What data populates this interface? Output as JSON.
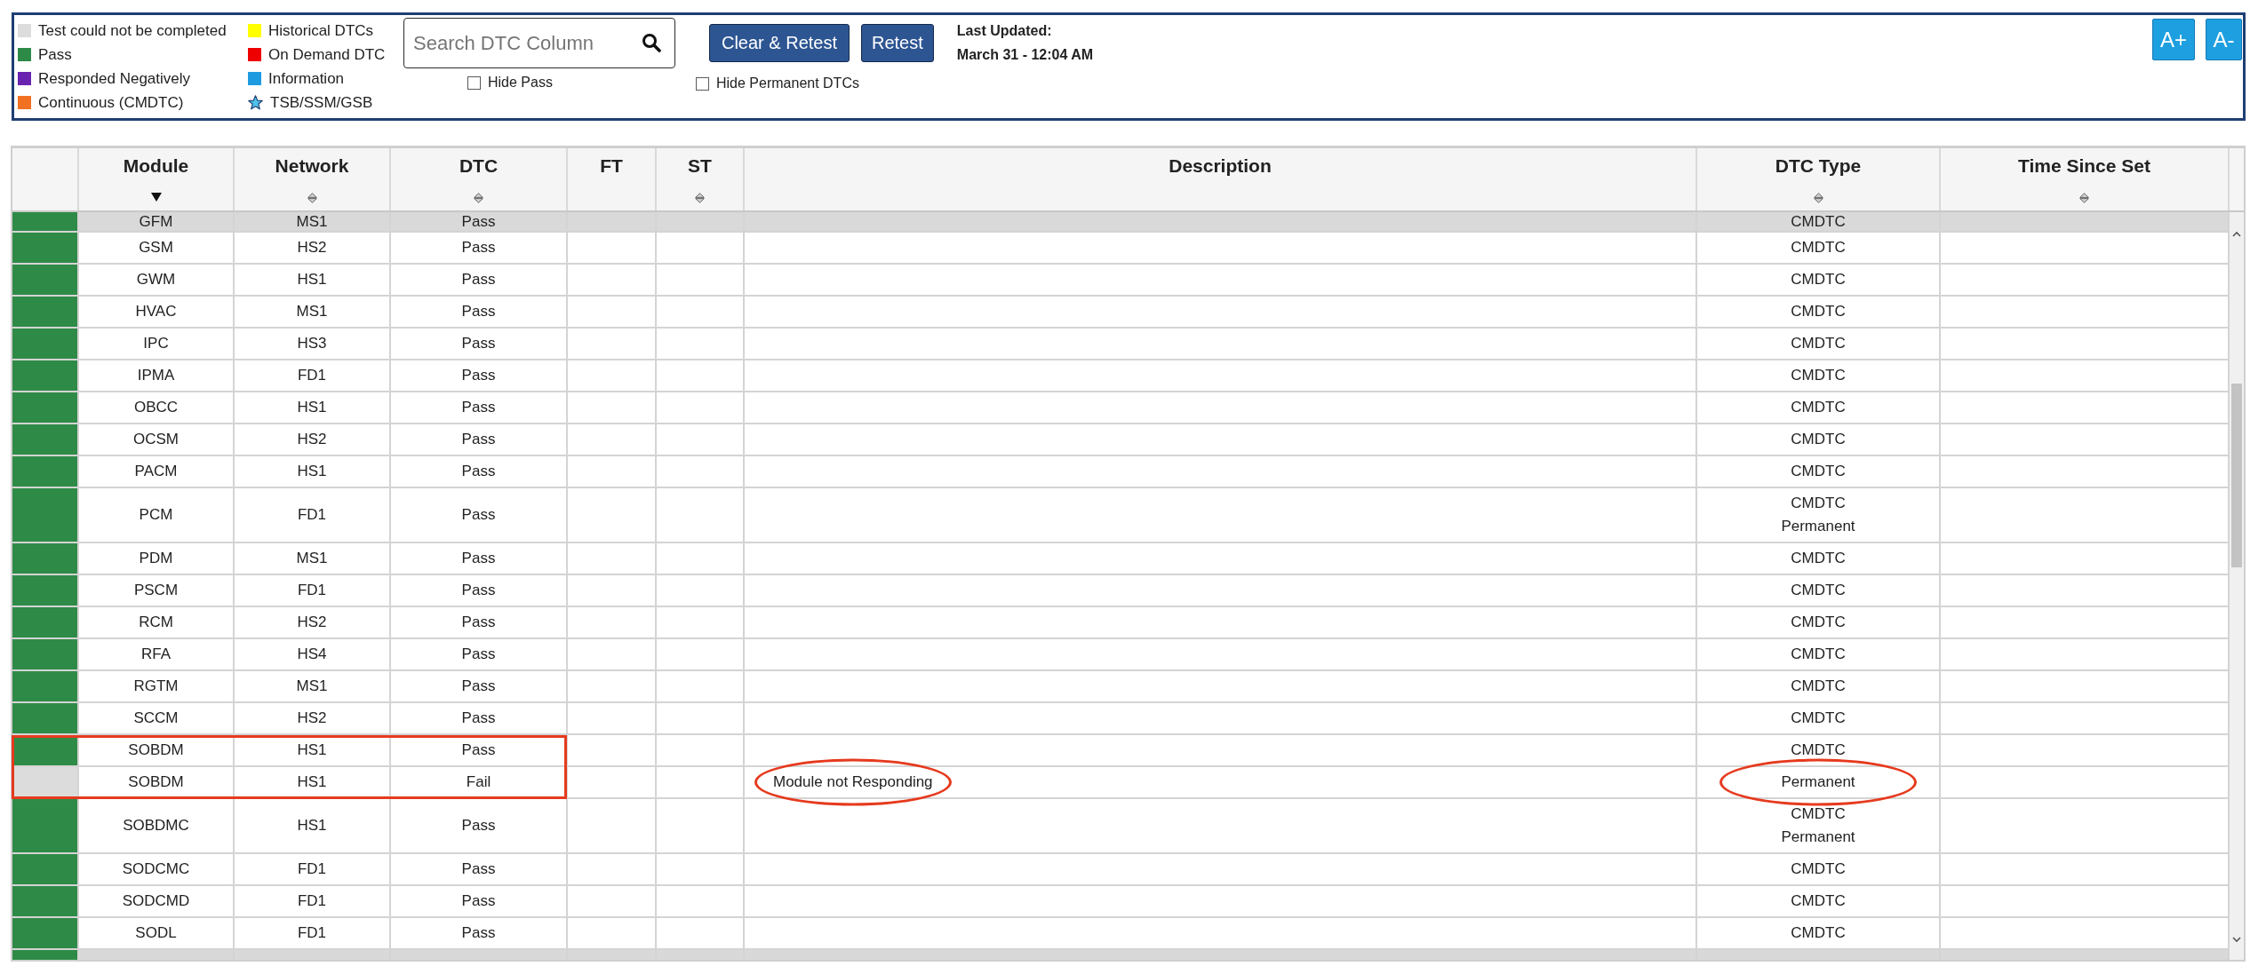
{
  "toolbar": {
    "legend": [
      {
        "label": "Test could not be completed",
        "color": "#dcdcdc",
        "kind": "swatch"
      },
      {
        "label": "Pass",
        "color": "#2e8b47",
        "kind": "swatch"
      },
      {
        "label": "Responded Negatively",
        "color": "#6a22b0",
        "kind": "swatch"
      },
      {
        "label": "Continuous (CMDTC)",
        "color": "#f27022",
        "kind": "swatch"
      },
      {
        "label": "Historical DTCs",
        "color": "#ffff00",
        "kind": "swatch"
      },
      {
        "label": "On Demand DTC",
        "color": "#ee0000",
        "kind": "swatch"
      },
      {
        "label": "Information",
        "color": "#1e9be0",
        "kind": "swatch"
      },
      {
        "label": "TSB/SSM/GSB",
        "color": "#4fc3ea",
        "kind": "star"
      }
    ],
    "search": {
      "placeholder": "Search DTC Column"
    },
    "hide_pass": {
      "label": "Hide Pass",
      "checked": false
    },
    "actions": [
      "Clear & Retest",
      "Retest"
    ],
    "hide_permanent": {
      "label": "Hide Permanent DTCs",
      "checked": false
    },
    "last_updated": {
      "label": "Last Updated:",
      "value": "March 31 - 12:04 AM"
    },
    "font_size_buttons": [
      "A+",
      "A-"
    ]
  },
  "table": {
    "columns": [
      {
        "label": "Module",
        "sortable": true,
        "sorted": true
      },
      {
        "label": "Network",
        "sortable": true,
        "sorted": false
      },
      {
        "label": "DTC",
        "sortable": true,
        "sorted": false
      },
      {
        "label": "FT",
        "sortable": false,
        "sorted": false
      },
      {
        "label": "ST",
        "sortable": true,
        "sorted": false
      },
      {
        "label": "Description",
        "sortable": false,
        "sorted": false
      },
      {
        "label": "DTC Type",
        "sortable": true,
        "sorted": false
      },
      {
        "label": "Time Since Set",
        "sortable": true,
        "sorted": false
      }
    ],
    "rows": [
      {
        "color": "#2e8b47",
        "module": "GFM",
        "network": "MS1",
        "dtc": "Pass",
        "dtc_type": [
          "CMDTC"
        ],
        "highlighted": true,
        "boxed": false,
        "circled": false
      },
      {
        "color": "#2e8b47",
        "module": "GSM",
        "network": "HS2",
        "dtc": "Pass",
        "dtc_type": [
          "CMDTC"
        ],
        "highlighted": false,
        "boxed": false,
        "circled": false
      },
      {
        "color": "#2e8b47",
        "module": "GWM",
        "network": "HS1",
        "dtc": "Pass",
        "dtc_type": [
          "CMDTC"
        ],
        "highlighted": false,
        "boxed": false,
        "circled": false
      },
      {
        "color": "#2e8b47",
        "module": "HVAC",
        "network": "MS1",
        "dtc": "Pass",
        "dtc_type": [
          "CMDTC"
        ],
        "highlighted": false,
        "boxed": false,
        "circled": false
      },
      {
        "color": "#2e8b47",
        "module": "IPC",
        "network": "HS3",
        "dtc": "Pass",
        "dtc_type": [
          "CMDTC"
        ],
        "highlighted": false,
        "boxed": false,
        "circled": false
      },
      {
        "color": "#2e8b47",
        "module": "IPMA",
        "network": "FD1",
        "dtc": "Pass",
        "dtc_type": [
          "CMDTC"
        ],
        "highlighted": false,
        "boxed": false,
        "circled": false
      },
      {
        "color": "#2e8b47",
        "module": "OBCC",
        "network": "HS1",
        "dtc": "Pass",
        "dtc_type": [
          "CMDTC"
        ],
        "highlighted": false,
        "boxed": false,
        "circled": false
      },
      {
        "color": "#2e8b47",
        "module": "OCSM",
        "network": "HS2",
        "dtc": "Pass",
        "dtc_type": [
          "CMDTC"
        ],
        "highlighted": false,
        "boxed": false,
        "circled": false
      },
      {
        "color": "#2e8b47",
        "module": "PACM",
        "network": "HS1",
        "dtc": "Pass",
        "dtc_type": [
          "CMDTC"
        ],
        "highlighted": false,
        "boxed": false,
        "circled": false
      },
      {
        "color": "#2e8b47",
        "module": "PCM",
        "network": "FD1",
        "dtc": "Pass",
        "dtc_type": [
          "CMDTC",
          "Permanent"
        ],
        "highlighted": false,
        "boxed": false,
        "circled": false
      },
      {
        "color": "#2e8b47",
        "module": "PDM",
        "network": "MS1",
        "dtc": "Pass",
        "dtc_type": [
          "CMDTC"
        ],
        "highlighted": false,
        "boxed": false,
        "circled": false
      },
      {
        "color": "#2e8b47",
        "module": "PSCM",
        "network": "FD1",
        "dtc": "Pass",
        "dtc_type": [
          "CMDTC"
        ],
        "highlighted": false,
        "boxed": false,
        "circled": false
      },
      {
        "color": "#2e8b47",
        "module": "RCM",
        "network": "HS2",
        "dtc": "Pass",
        "dtc_type": [
          "CMDTC"
        ],
        "highlighted": false,
        "boxed": false,
        "circled": false
      },
      {
        "color": "#2e8b47",
        "module": "RFA",
        "network": "HS4",
        "dtc": "Pass",
        "dtc_type": [
          "CMDTC"
        ],
        "highlighted": false,
        "boxed": false,
        "circled": false
      },
      {
        "color": "#2e8b47",
        "module": "RGTM",
        "network": "MS1",
        "dtc": "Pass",
        "dtc_type": [
          "CMDTC"
        ],
        "highlighted": false,
        "boxed": false,
        "circled": false
      },
      {
        "color": "#2e8b47",
        "module": "SCCM",
        "network": "HS2",
        "dtc": "Pass",
        "dtc_type": [
          "CMDTC"
        ],
        "highlighted": false,
        "boxed": false,
        "circled": false
      },
      {
        "color": "#2e8b47",
        "module": "SOBDM",
        "network": "HS1",
        "dtc": "Pass",
        "dtc_type": [
          "CMDTC"
        ],
        "highlighted": false,
        "boxed": true,
        "circled": false
      },
      {
        "color": "#dcdcdc",
        "module": "SOBDM",
        "network": "HS1",
        "dtc": "Fail",
        "description": "Module not Responding",
        "dtc_type": [
          "Permanent"
        ],
        "highlighted": false,
        "boxed": true,
        "circled": true
      },
      {
        "color": "#2e8b47",
        "module": "SOBDMC",
        "network": "HS1",
        "dtc": "Pass",
        "dtc_type": [
          "CMDTC",
          "Permanent"
        ],
        "highlighted": false,
        "boxed": false,
        "circled": false
      },
      {
        "color": "#2e8b47",
        "module": "SODCMC",
        "network": "FD1",
        "dtc": "Pass",
        "dtc_type": [
          "CMDTC"
        ],
        "highlighted": false,
        "boxed": false,
        "circled": false
      },
      {
        "color": "#2e8b47",
        "module": "SODCMD",
        "network": "FD1",
        "dtc": "Pass",
        "dtc_type": [
          "CMDTC"
        ],
        "highlighted": false,
        "boxed": false,
        "circled": false
      },
      {
        "color": "#2e8b47",
        "module": "SODL",
        "network": "FD1",
        "dtc": "Pass",
        "dtc_type": [
          "CMDTC"
        ],
        "highlighted": false,
        "boxed": false,
        "circled": false
      },
      {
        "color": "#2e8b47",
        "highlighted": true,
        "boxed": false
      }
    ]
  }
}
